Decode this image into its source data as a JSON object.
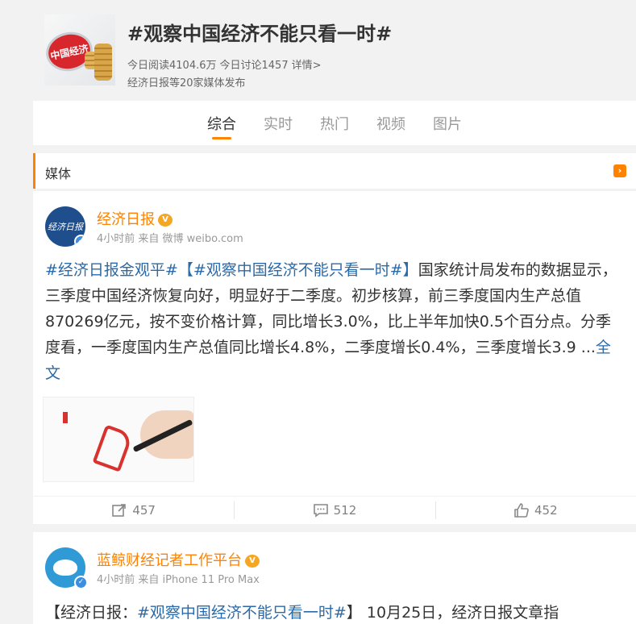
{
  "topic": {
    "thumb_text": "中国经济",
    "title": "#观察中国经济不能只看一时#",
    "reads": "今日阅读4104.6万",
    "discussions": "今日讨论1457",
    "details": "详情>",
    "source": "经济日报等20家媒体发布"
  },
  "tabs": [
    {
      "label": "综合"
    },
    {
      "label": "实时"
    },
    {
      "label": "热门"
    },
    {
      "label": "视频"
    },
    {
      "label": "图片"
    }
  ],
  "media_bar": {
    "label": "媒体",
    "arrow": "›"
  },
  "posts": [
    {
      "user": "经济日报",
      "meta": "4小时前 来自 微博 weibo.com",
      "avatar_text": "经济日报",
      "text_tag1": "#经济日报金观平#",
      "text_tag2": "【#观察中国经济不能只看一时#】",
      "text_body": "国家统计局发布的数据显示，三季度中国经济恢复向好，明显好于二季度。初步核算，前三季度国内生产总值870269亿元，按不变价格计算，同比增长3.0%，比上半年加快0.5个百分点。分季度看，一季度国内生产总值同比增长4.8%，二季度增长0.4%，三季度增长3.9 ...",
      "more": "全文",
      "repost": "457",
      "comment": "512",
      "like": "452"
    },
    {
      "user": "蓝鲸财经记者工作平台",
      "meta": "4小时前 来自 iPhone 11 Pro Max",
      "text_pre": "【经济日报：",
      "text_tag": "#观察中国经济不能只看一时#",
      "text_post": "】 10月25日，经济日报文章指"
    }
  ]
}
